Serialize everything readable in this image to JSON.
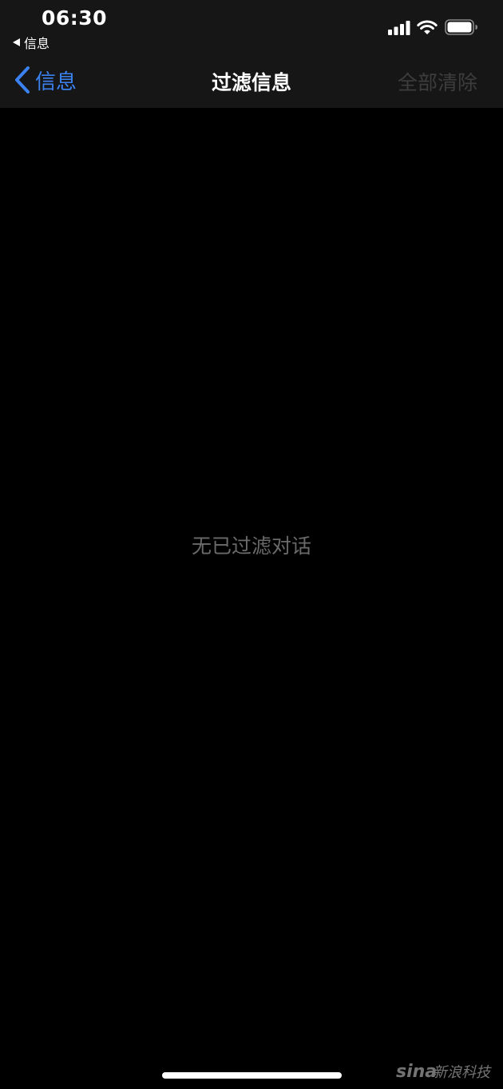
{
  "status_bar": {
    "time": "06:30",
    "return_app_label": "信息",
    "icons": [
      "cellular-signal-icon",
      "wifi-icon",
      "battery-icon"
    ]
  },
  "nav": {
    "back_label": "信息",
    "title": "过滤信息",
    "clear_all_label": "全部清除"
  },
  "content": {
    "empty_message": "无已过滤对话"
  },
  "watermark": {
    "text": "新浪科技"
  },
  "colors": {
    "accent": "#3b82f0",
    "disabled_text": "#3d3d3d",
    "empty_text": "#6a6a6a",
    "bar_background": "#161616",
    "background": "#000000"
  }
}
